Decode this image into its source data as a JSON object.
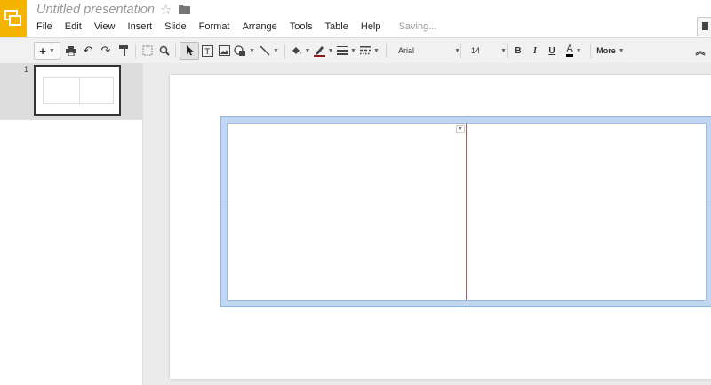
{
  "app": {
    "title": "Untitled presentation",
    "status": "Saving..."
  },
  "menu": [
    "File",
    "Edit",
    "View",
    "Insert",
    "Slide",
    "Format",
    "Arrange",
    "Tools",
    "Table",
    "Help"
  ],
  "toolbar": {
    "plus": "+",
    "font_name": "Arial",
    "font_size": "14",
    "bold": "B",
    "italic": "I",
    "underline": "U",
    "text_color": "A",
    "more": "More"
  },
  "filmstrip": {
    "slides": [
      {
        "number": "1"
      }
    ]
  },
  "colors": {
    "logo": "#f4b400",
    "table_border": "#c1d6f0",
    "column_line": "#b05c5c",
    "font_color_bar": "#000000",
    "fill_color_bar": "#ffffff",
    "line_color_bar": "#8b1a1a"
  }
}
